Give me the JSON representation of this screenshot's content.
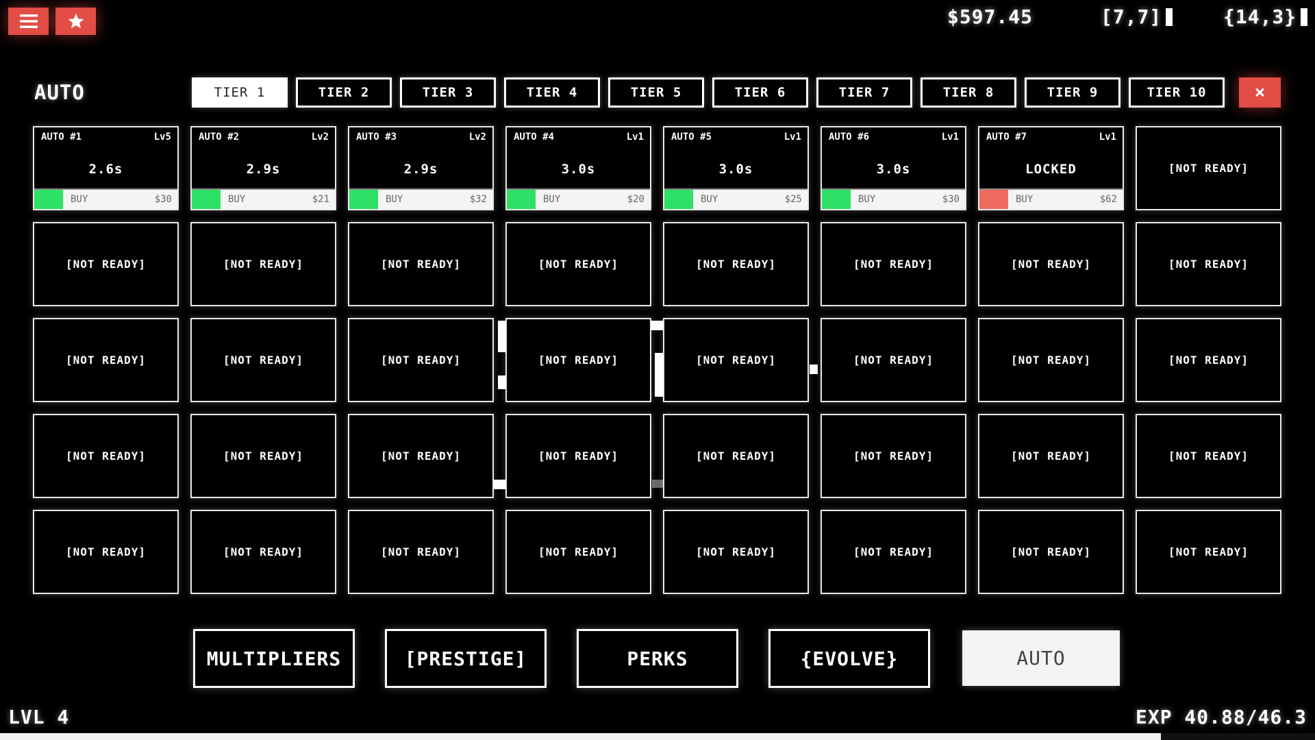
{
  "topbar": {
    "money": "$597.45",
    "coord_a": "[7,7]",
    "coord_b": "{14,3}"
  },
  "panel": {
    "title": "AUTO",
    "close_label": "×",
    "tabs": [
      {
        "label": "TIER 1",
        "active": true
      },
      {
        "label": "TIER 2"
      },
      {
        "label": "TIER 3"
      },
      {
        "label": "TIER 4"
      },
      {
        "label": "TIER 5"
      },
      {
        "label": "TIER 6"
      },
      {
        "label": "TIER 7"
      },
      {
        "label": "TIER 8"
      },
      {
        "label": "TIER 9"
      },
      {
        "label": "TIER 10"
      }
    ]
  },
  "autos": [
    {
      "name": "AUTO #1",
      "level": "Lv5",
      "time": "2.6s",
      "buy": "BUY",
      "price": "$30",
      "progress": 0.2,
      "status": "ok"
    },
    {
      "name": "AUTO #2",
      "level": "Lv2",
      "time": "2.9s",
      "buy": "BUY",
      "price": "$21",
      "progress": 0.2,
      "status": "ok"
    },
    {
      "name": "AUTO #3",
      "level": "Lv2",
      "time": "2.9s",
      "buy": "BUY",
      "price": "$32",
      "progress": 0.2,
      "status": "ok"
    },
    {
      "name": "AUTO #4",
      "level": "Lv1",
      "time": "3.0s",
      "buy": "BUY",
      "price": "$20",
      "progress": 0.2,
      "status": "ok"
    },
    {
      "name": "AUTO #5",
      "level": "Lv1",
      "time": "3.0s",
      "buy": "BUY",
      "price": "$25",
      "progress": 0.2,
      "status": "ok"
    },
    {
      "name": "AUTO #6",
      "level": "Lv1",
      "time": "3.0s",
      "buy": "BUY",
      "price": "$30",
      "progress": 0.2,
      "status": "ok"
    },
    {
      "name": "AUTO #7",
      "level": "Lv1",
      "time": "LOCKED",
      "buy": "BUY",
      "price": "$62",
      "progress": 0.2,
      "status": "locked"
    }
  ],
  "placeholder_text": "[NOT READY]",
  "grid": {
    "columns": 8,
    "rows": 5
  },
  "colors": {
    "ok": "#2fe066",
    "locked": "#f06a62",
    "accent": "#e24d45"
  },
  "nav": [
    {
      "label": "MULTIPLIERS"
    },
    {
      "label": "[PRESTIGE]"
    },
    {
      "label": "PERKS"
    },
    {
      "label": "{EVOLVE}"
    },
    {
      "label": "AUTO",
      "active": true
    }
  ],
  "footer": {
    "level": "LVL 4",
    "exp": "EXP 40.88/46.3",
    "exp_fraction": 0.883
  }
}
